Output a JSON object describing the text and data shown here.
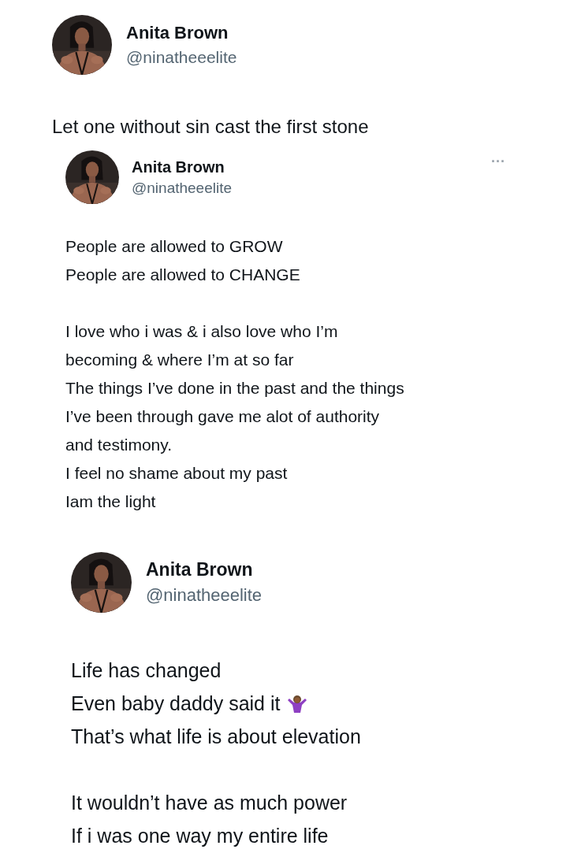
{
  "posts": [
    {
      "name": "Anita Brown",
      "handle": "@ninatheeelite",
      "paragraphs": [
        [
          {
            "text": "Let one without sin cast the first stone",
            "kind": "plain"
          }
        ]
      ]
    },
    {
      "name": "Anita Brown",
      "handle": "@ninatheeelite",
      "menu": "···",
      "paragraphs": [
        [
          {
            "text": "People are allowed to GROW",
            "kind": "plain"
          },
          {
            "text": "People are allowed to CHANGE",
            "kind": "plain"
          }
        ],
        [
          {
            "text": "I love who i was & i also love who I’m",
            "kind": "plain"
          },
          {
            "text": "becoming & where I’m at so far",
            "kind": "plain"
          },
          {
            "text": "The things I’ve done in the past and the things",
            "kind": "plain"
          },
          {
            "text": "I’ve been through gave me alot of authority",
            "kind": "plain"
          },
          {
            "text": "and testimony.",
            "kind": "plain"
          },
          {
            "text": "I feel no shame about my past",
            "kind": "plain"
          },
          {
            "text": "Iam the light",
            "kind": "plain"
          }
        ]
      ]
    },
    {
      "name": "Anita Brown",
      "handle": "@ninatheeelite",
      "paragraphs": [
        [
          {
            "text": "Life has changed",
            "kind": "plain"
          },
          {
            "text": "Even baby daddy said it",
            "kind": "shrug"
          },
          {
            "text": "That’s what life is about elevation",
            "kind": "plain"
          }
        ],
        [
          {
            "text": "It wouldn’t have as much power",
            "kind": "plain"
          },
          {
            "text": "If i was one way my entire life",
            "kind": "plain"
          }
        ]
      ]
    }
  ]
}
